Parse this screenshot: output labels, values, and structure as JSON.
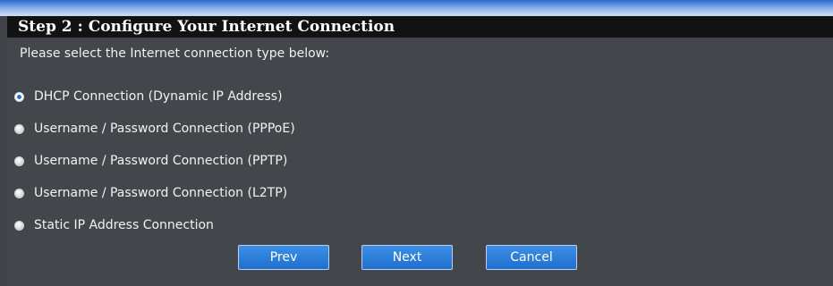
{
  "header": {
    "title": "Step 2 : Configure Your Internet Connection"
  },
  "instruction": "Please select the Internet connection type below:",
  "connection_types": [
    {
      "label": "DHCP Connection (Dynamic IP Address)",
      "selected": true
    },
    {
      "label": "Username / Password Connection (PPPoE)",
      "selected": false
    },
    {
      "label": "Username / Password Connection (PPTP)",
      "selected": false
    },
    {
      "label": "Username / Password Connection (L2TP)",
      "selected": false
    },
    {
      "label": "Static IP Address Connection",
      "selected": false
    }
  ],
  "buttons": {
    "prev_label": "Prev",
    "next_label": "Next",
    "cancel_label": "Cancel"
  },
  "colors": {
    "accent_blue": "#2a7bd9",
    "header_background": "#121212",
    "panel_background": "#43464b"
  }
}
